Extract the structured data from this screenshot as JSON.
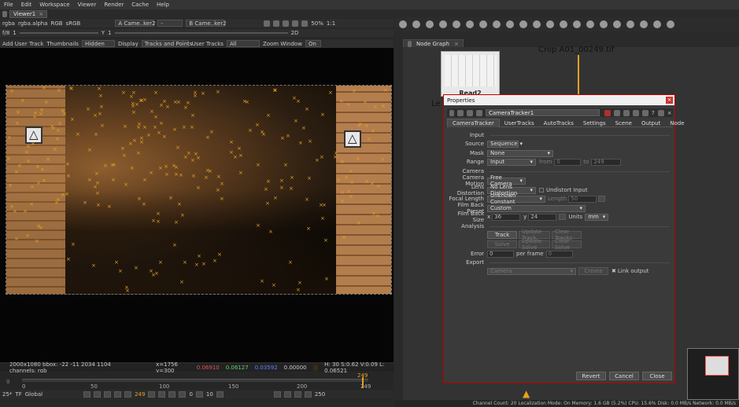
{
  "menu": [
    "File",
    "Edit",
    "Workspace",
    "Viewer",
    "Render",
    "Cache",
    "Help"
  ],
  "viewer_tab": "Viewer1",
  "viewer_toolbar1": {
    "channels": "rgba",
    "alpha": "rgba.alpha",
    "color": "RGB",
    "lut": "sRGB",
    "input_a": "A  Came..ker2",
    "input_sep": "-",
    "input_b": "B  Came..ker2",
    "zoom": "50%",
    "ratio": "1:1"
  },
  "viewer_toolbar2": {
    "fstop": "f/8",
    "gain": "1",
    "y_label": "Y",
    "y_value": "1",
    "view_mode": "2D"
  },
  "viewer_toolbar3": {
    "add_track": "Add User Track",
    "thumbnails_label": "Thumbnails",
    "thumbnails_value": "Hidden",
    "display_label": "Display",
    "display_value": "Tracks and Points",
    "user_tracks_label": "User Tracks",
    "user_tracks_value": "All",
    "zoom_window_label": "Zoom Window",
    "zoom_window_value": "On"
  },
  "info_bar": {
    "format": "2000x1080  bbox: -22 -11 2034 1104 channels: rgb",
    "coords": "x=1756 y=300",
    "r": "0.06910",
    "g": "0.06127",
    "b": "0.03592",
    "a": "0.00000",
    "hsvl": "H: 30 S:0.62 V:0.09  L: 0.06521"
  },
  "timeline": {
    "ticks": [
      "0",
      "50",
      "100",
      "150",
      "200",
      "249"
    ],
    "start": "0",
    "end_top": "249",
    "end": "250",
    "fps": "25*",
    "tf": "TF",
    "scope": "Global",
    "current_frame": "249",
    "step": "10",
    "range_start": "0",
    "play_step": "10"
  },
  "node_graph": {
    "tab": "Node Graph",
    "read_node_label": "Read2",
    "crop_node_label": "Crop A01_00249.tif",
    "left_label": "Le"
  },
  "properties": {
    "title": "Properties",
    "node_name": "CameraTracker1",
    "tabs": [
      "CameraTracker",
      "UserTracks",
      "AutoTracks",
      "Settings",
      "Scene",
      "Output",
      "Node"
    ],
    "sections": {
      "input": "Input",
      "camera": "Camera",
      "analysis": "Analysis",
      "export": "Export"
    },
    "source_label": "Source",
    "source_value": "Sequence",
    "mask_label": "Mask",
    "mask_value": "None",
    "range_label": "Range",
    "range_value": "Input",
    "range_from_label": "from",
    "range_from": "0",
    "range_to_label": "to",
    "range_to": "249",
    "camera_motion_label": "Camera Motion",
    "camera_motion_value": "Free Camera",
    "lens_distortion_label": "Lens Distortion",
    "lens_distortion_value": "No Lens Distortion",
    "undistort_label": "Undistort Input",
    "focal_length_label": "Focal Length",
    "focal_length_value": "Unknown Constant",
    "focal_length_length_label": "Length",
    "focal_length_length": "50",
    "film_back_preset_label": "Film Back Preset",
    "film_back_preset_value": "Custom",
    "film_back_size_label": "Film Back Size",
    "film_back_x_label": "x",
    "film_back_x": "36",
    "film_back_y_label": "y",
    "film_back_y": "24",
    "units_label": "Units",
    "units_value": "mm",
    "analysis_buttons_row1": [
      "Track",
      "Update Track",
      "Clear Tracks"
    ],
    "analysis_buttons_row2": [
      "Solve",
      "Update Solve",
      "Clear Solve"
    ],
    "error_label": "Error",
    "error_value": "0",
    "per_frame_label": "per frame",
    "per_frame_value": "0",
    "export_value": "Camera",
    "create_label": "Create",
    "link_output_label": "Link output",
    "revert": "Revert",
    "cancel": "Cancel",
    "close": "Close"
  },
  "status_bar": "Channel Count: 20  Localization Mode: On  Memory: 1.6 GB (5.2%)  CPU: 15.6%  Disk: 0.0 MB/s  Network: 0.0 MB/s"
}
